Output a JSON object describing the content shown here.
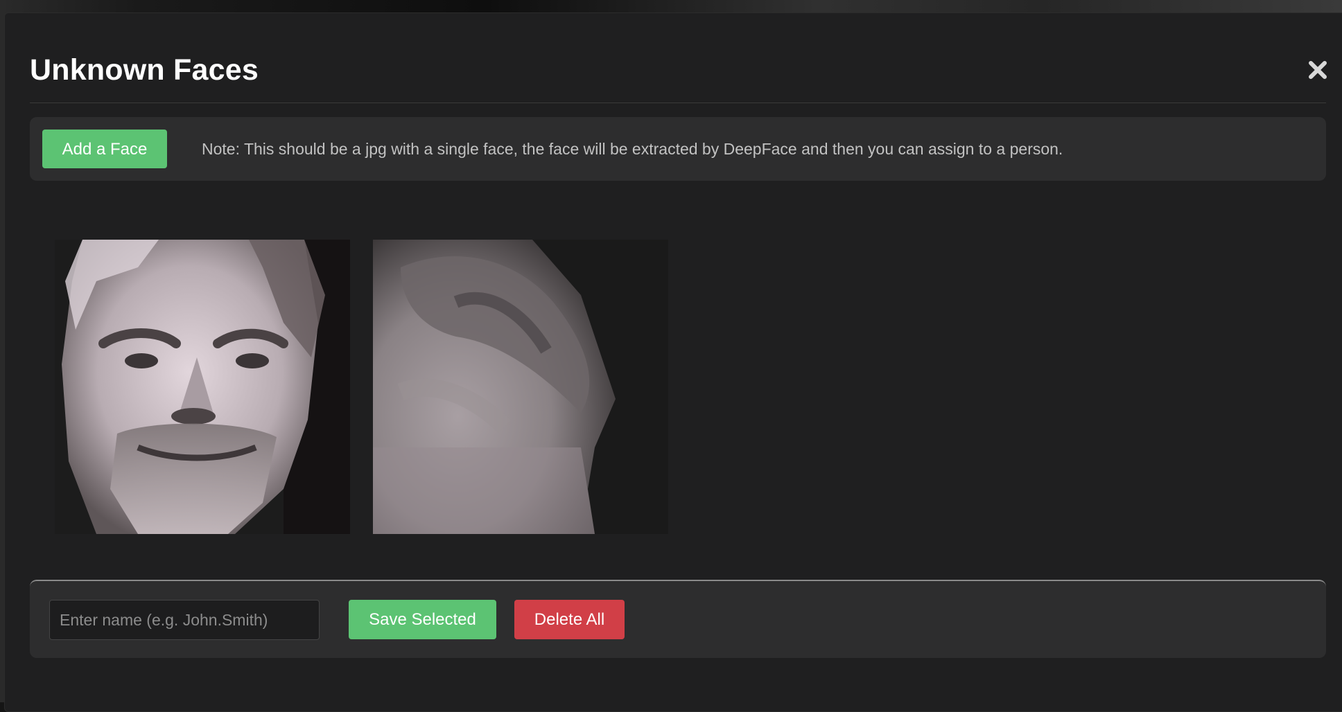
{
  "modal": {
    "title": "Unknown Faces",
    "close_icon": "close-icon"
  },
  "add_section": {
    "button_label": "Add a Face",
    "note": "Note: This should be a jpg with a single face, the face will be extracted by DeepFace and then you can assign to a person."
  },
  "faces": [
    {
      "icon": "face-image"
    },
    {
      "icon": "face-image"
    }
  ],
  "footer": {
    "name_placeholder": "Enter name (e.g. John.Smith)",
    "name_value": "",
    "save_label": "Save Selected",
    "delete_label": "Delete All"
  },
  "colors": {
    "primary": "#5cc373",
    "danger": "#d13f47",
    "panel": "#2d2d2e",
    "modal_bg": "#1f1f20"
  }
}
